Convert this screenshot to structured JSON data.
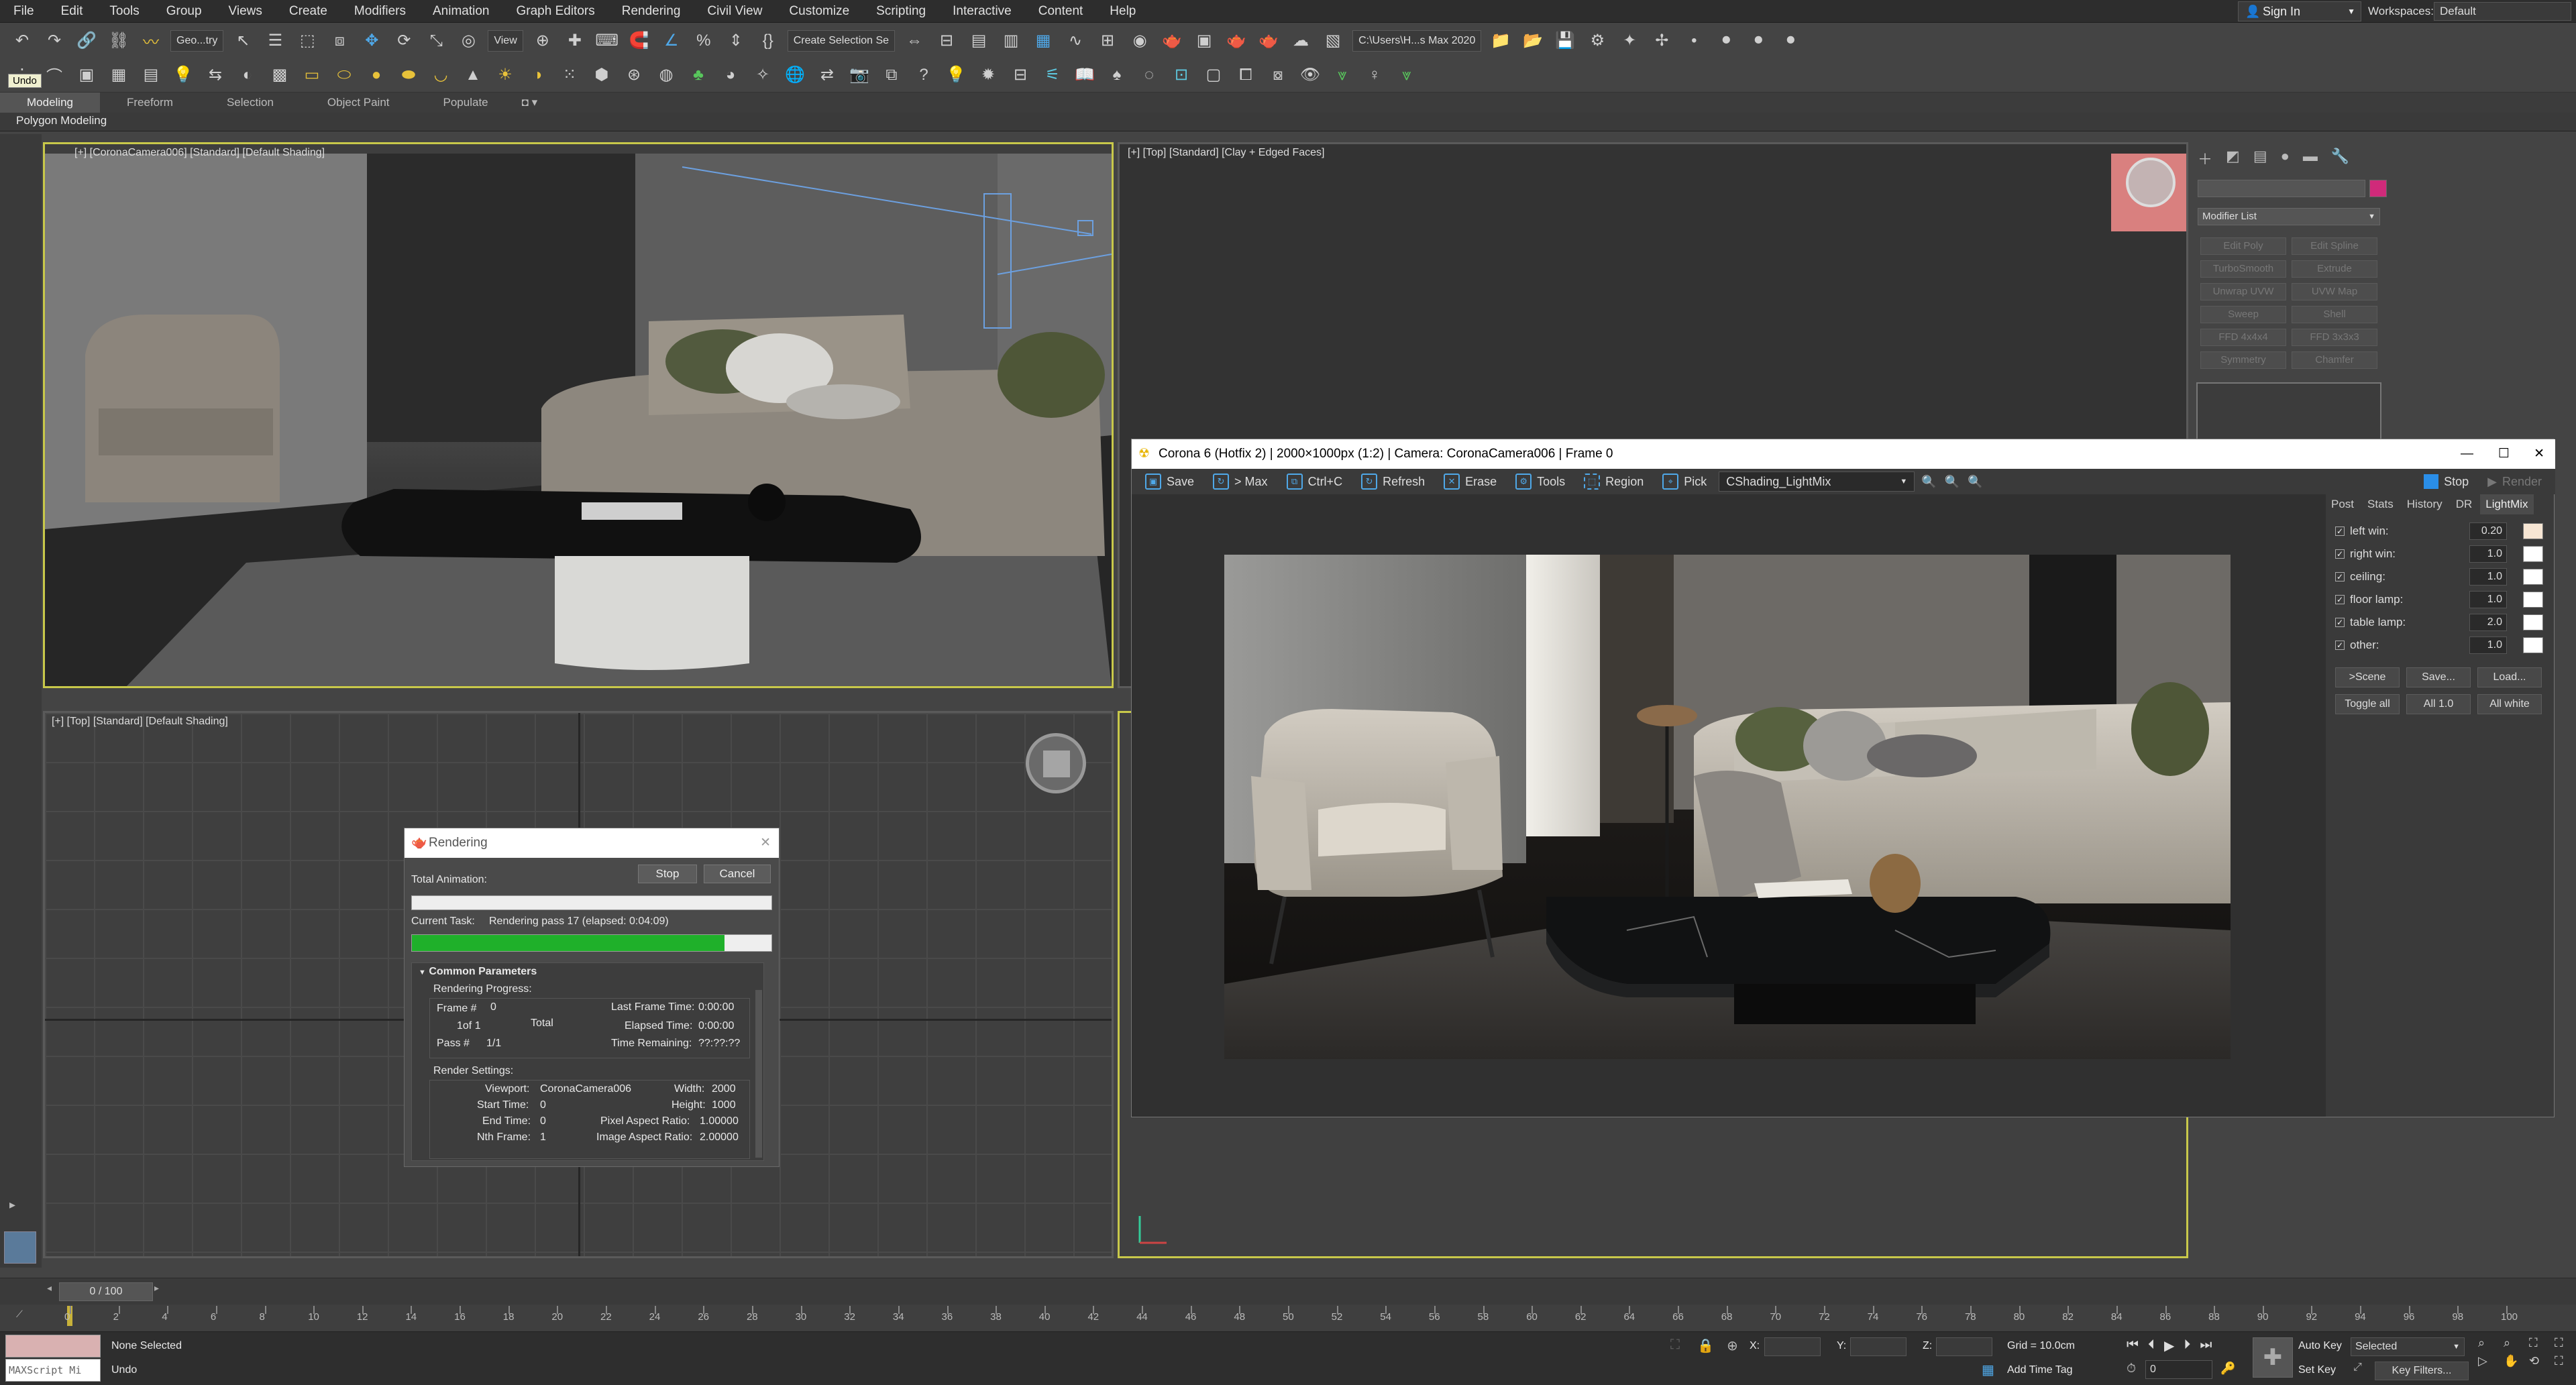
{
  "menubar": {
    "items": [
      "File",
      "Edit",
      "Tools",
      "Group",
      "Views",
      "Create",
      "Modifiers",
      "Animation",
      "Graph Editors",
      "Rendering",
      "Civil View",
      "Customize",
      "Scripting",
      "Interactive",
      "Content",
      "Help"
    ],
    "sign_in": "Sign In",
    "workspaces_label": "Workspaces:",
    "workspace_value": "Default"
  },
  "toolbar1": {
    "selection_filter": "Geo...try",
    "ref_coord": "View",
    "named_selection": "Create Selection Se",
    "project_path": "C:\\Users\\H...s Max 2020"
  },
  "undo_tooltip": "Undo",
  "ribbon": {
    "tabs": [
      "Modeling",
      "Freeform",
      "Selection",
      "Object Paint",
      "Populate"
    ],
    "active_tab": "Modeling",
    "sub_label": "Polygon Modeling"
  },
  "viewports": {
    "top_left_label": "[+] [CoronaCamera006] [Standard] [Default Shading]",
    "top_right_label": "[+] [Top] [Standard] [Clay + Edged Faces]",
    "bottom_left_label": "[+] [Top] [Standard] [Default Shading]"
  },
  "command_panel": {
    "modifier_list": "Modifier List",
    "modifiers": [
      "Edit Poly",
      "Edit Spline",
      "TurboSmooth",
      "Extrude",
      "Unwrap UVW",
      "UVW Map",
      "Sweep",
      "Shell",
      "FFD 4x4x4",
      "FFD 3x3x3",
      "Symmetry",
      "Chamfer"
    ],
    "accent_color": "#d02a7a"
  },
  "vfb": {
    "title": "Corona 6 (Hotfix 2) | 2000×1000px (1:2) | Camera: CoronaCamera006 | Frame 0",
    "toolbar": [
      "Save",
      "> Max",
      "Ctrl+C",
      "Refresh",
      "Erase",
      "Tools",
      "Region",
      "Pick"
    ],
    "channel": "CShading_LightMix",
    "stop": "Stop",
    "render": "Render",
    "side_tabs": [
      "Post",
      "Stats",
      "History",
      "DR",
      "LightMix"
    ],
    "active_side_tab": "LightMix",
    "lightmix": [
      {
        "name": "left win:",
        "value": "0.20",
        "color": "#f7e6d4"
      },
      {
        "name": "right win:",
        "value": "1.0",
        "color": "#ffffff"
      },
      {
        "name": "ceiling:",
        "value": "1.0",
        "color": "#ffffff"
      },
      {
        "name": "floor lamp:",
        "value": "1.0",
        "color": "#ffffff"
      },
      {
        "name": "table lamp:",
        "value": "2.0",
        "color": "#ffffff"
      },
      {
        "name": "other:",
        "value": "1.0",
        "color": "#ffffff"
      }
    ],
    "buttons_row1": [
      ">Scene",
      "Save...",
      "Load..."
    ],
    "buttons_row2": [
      "Toggle all",
      "All 1.0",
      "All white"
    ]
  },
  "render_dialog": {
    "title": "Rendering",
    "stop": "Stop",
    "cancel": "Cancel",
    "total_animation": "Total Animation:",
    "current_task_label": "Current Task:",
    "current_task": "Rendering pass 17 (elapsed: 0:04:09)",
    "progress": 0.87,
    "section": "Common Parameters",
    "rendering_progress": "Rendering Progress:",
    "frame_label": "Frame #",
    "frame_value": "0",
    "of_label": "1of 1",
    "total": "Total",
    "pass_label": "Pass #",
    "pass_value": "1/1",
    "last_frame_time": "Last Frame Time:",
    "last_frame_value": "0:00:00",
    "elapsed_time": "Elapsed Time:",
    "elapsed_value": "0:00:00",
    "time_remaining": "Time Remaining:",
    "time_remaining_value": "??:??:??",
    "render_settings": "Render Settings:",
    "viewport_label": "Viewport:",
    "viewport_value": "CoronaCamera006",
    "width_label": "Width:",
    "width_value": "2000",
    "start_label": "Start Time:",
    "start_value": "0",
    "height_label": "Height:",
    "height_value": "1000",
    "end_label": "End Time:",
    "end_value": "0",
    "pixel_aspect_label": "Pixel Aspect Ratio:",
    "pixel_aspect_value": "1.00000",
    "nth_label": "Nth Frame:",
    "nth_value": "1",
    "image_aspect_label": "Image Aspect Ratio:",
    "image_aspect_value": "2.00000"
  },
  "timeline": {
    "slider": "0 / 100",
    "ticks": [
      "0",
      "2",
      "4",
      "6",
      "8",
      "10",
      "12",
      "14",
      "16",
      "18",
      "20",
      "22",
      "24",
      "26",
      "28",
      "30",
      "32",
      "34",
      "36",
      "38",
      "40",
      "42",
      "44",
      "46",
      "48",
      "50",
      "52",
      "54",
      "56",
      "58",
      "60",
      "62",
      "64",
      "66",
      "68",
      "70",
      "72",
      "74",
      "76",
      "78",
      "80",
      "82",
      "84",
      "86",
      "88",
      "90",
      "92",
      "94",
      "96",
      "98",
      "100"
    ]
  },
  "status": {
    "maxscript": "MAXScript Mi",
    "selection": "None Selected",
    "prompt": "Undo",
    "x_label": "X:",
    "y_label": "Y:",
    "z_label": "Z:",
    "grid": "Grid = 10.0cm",
    "add_time_tag": "Add Time Tag",
    "auto_key": "Auto Key",
    "set_key": "Set Key",
    "selected": "Selected",
    "key_filters": "Key Filters...",
    "frame": "0"
  }
}
